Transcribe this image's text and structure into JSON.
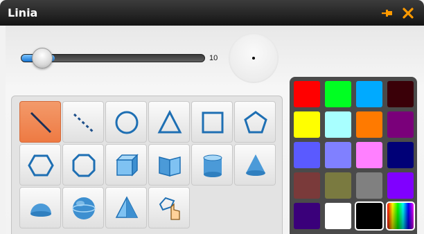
{
  "window": {
    "title": "Linia"
  },
  "titlebar": {
    "pin_icon": "pin-icon",
    "close_icon": "close-icon",
    "accent": "#ff9a00"
  },
  "size_slider": {
    "value": "10",
    "fraction": 0.12
  },
  "preview": {
    "icon": "dot"
  },
  "shapes": [
    {
      "name": "line-tool",
      "icon": "line-icon",
      "active": true
    },
    {
      "name": "dotted-line-tool",
      "icon": "dotted-line-icon"
    },
    {
      "name": "circle-tool",
      "icon": "circle-icon"
    },
    {
      "name": "triangle-tool",
      "icon": "triangle-icon"
    },
    {
      "name": "square-tool",
      "icon": "square-icon"
    },
    {
      "name": "pentagon-tool",
      "icon": "pentagon-icon"
    },
    {
      "name": "hexagon-tool",
      "icon": "hexagon-icon"
    },
    {
      "name": "octagon-tool",
      "icon": "octagon-icon"
    },
    {
      "name": "cube-tool",
      "icon": "cube-icon"
    },
    {
      "name": "prism-tool",
      "icon": "prism-icon"
    },
    {
      "name": "cylinder-tool",
      "icon": "cylinder-icon"
    },
    {
      "name": "cone-tool",
      "icon": "cone-icon"
    },
    {
      "name": "hemisphere-tool",
      "icon": "hemisphere-icon"
    },
    {
      "name": "sphere-tool",
      "icon": "sphere-icon"
    },
    {
      "name": "pyramid-tool",
      "icon": "pyramid-icon"
    },
    {
      "name": "freeform-polygon-tool",
      "icon": "freeform-polygon-icon"
    }
  ],
  "colors": [
    "#ff0000",
    "#00ff22",
    "#00aaff",
    "#3a0008",
    "#ffff00",
    "#a8ffff",
    "#ff7a00",
    "#7a007a",
    "#5a5aff",
    "#8080ff",
    "#ff80ff",
    "#000077",
    "#7a3a3a",
    "#7a7a40",
    "#808080",
    "#8000ff",
    "#3a007a",
    "#ffffff",
    "#000000",
    "spectrum"
  ],
  "selected_color": "#000000"
}
